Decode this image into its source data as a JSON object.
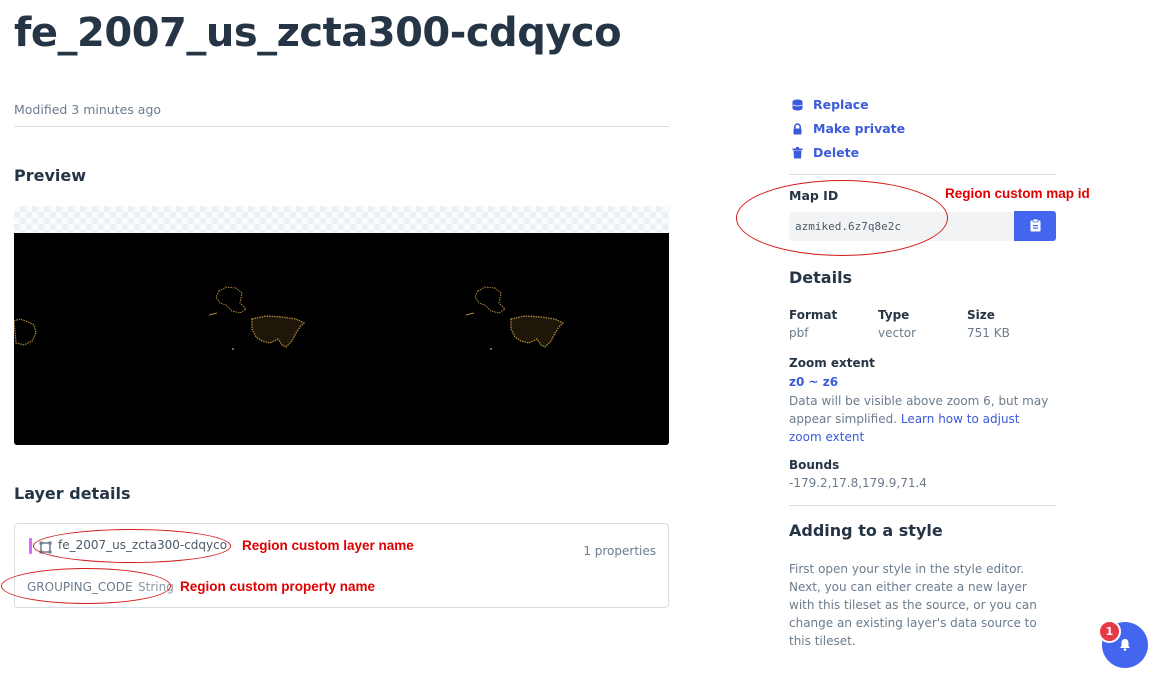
{
  "page": {
    "title": "fe_2007_us_zcta300-cdqyco",
    "modified": "Modified 3 minutes ago"
  },
  "preview": {
    "heading": "Preview"
  },
  "layer_details": {
    "heading": "Layer details",
    "layer_name": "fe_2007_us_zcta300-cdqyco",
    "properties_count": "1 properties",
    "property_name": "GROUPING_CODE",
    "property_type": "String"
  },
  "actions": [
    {
      "label": "Replace",
      "icon": "database-icon"
    },
    {
      "label": "Make private",
      "icon": "lock-icon"
    },
    {
      "label": "Delete",
      "icon": "trash-icon"
    }
  ],
  "map_id": {
    "label": "Map ID",
    "value": "azmiked.6z7q8e2c",
    "copy_icon": "clipboard-icon"
  },
  "details": {
    "heading": "Details",
    "format_label": "Format",
    "format_value": "pbf",
    "type_label": "Type",
    "type_value": "vector",
    "size_label": "Size",
    "size_value": "751 KB",
    "zoom_label": "Zoom extent",
    "zoom_value": "z0 ~ z6",
    "zoom_note": "Data will be visible above zoom 6, but may appear simplified.",
    "zoom_link": "Learn how to adjust zoom extent",
    "bounds_label": "Bounds",
    "bounds_value": "-179.2,17.8,179.9,71.4"
  },
  "adding": {
    "heading": "Adding to a style",
    "text": "First open your style in the style editor. Next, you can either create a new layer with this tileset as the source, or you can change an existing layer's data source to this tileset."
  },
  "annotations": {
    "map_id": "Region custom map id",
    "layer_name": "Region custom layer name",
    "property_name": "Region custom property name"
  },
  "notifications": {
    "count": "1",
    "icon": "bell-icon"
  },
  "colors": {
    "accent": "#4466ee",
    "link": "#3b5bdb",
    "annotation": "#e00000",
    "badge": "#e63946",
    "map_features": "#b08a3a"
  }
}
